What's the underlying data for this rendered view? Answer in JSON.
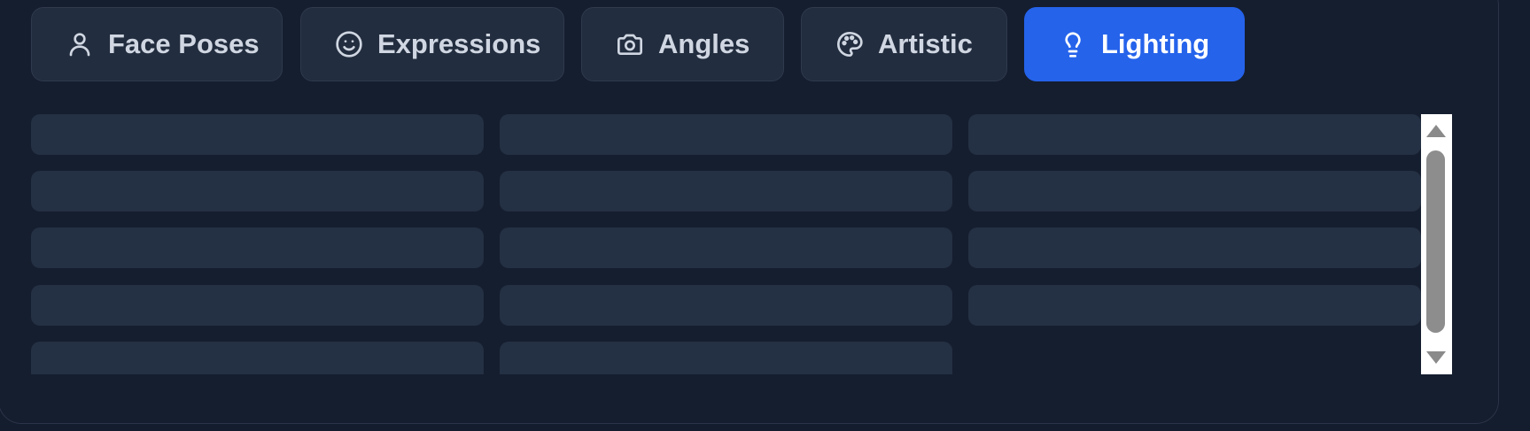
{
  "tabs": [
    {
      "label": "Face Poses",
      "icon": "user-icon",
      "active": false
    },
    {
      "label": "Expressions",
      "icon": "smile-icon",
      "active": false
    },
    {
      "label": "Angles",
      "icon": "camera-icon",
      "active": false
    },
    {
      "label": "Artistic",
      "icon": "palette-icon",
      "active": false
    },
    {
      "label": "Lighting",
      "icon": "lightbulb-icon",
      "active": true
    }
  ],
  "colors": {
    "background": "#151e2f",
    "tab_inactive": "#222d3f",
    "tab_active": "#2563eb",
    "skeleton": "#243043",
    "scrollbar_thumb": "#8d8d8d"
  },
  "skeleton_grid": {
    "columns": 3,
    "items_per_column": [
      5,
      5,
      4
    ]
  }
}
